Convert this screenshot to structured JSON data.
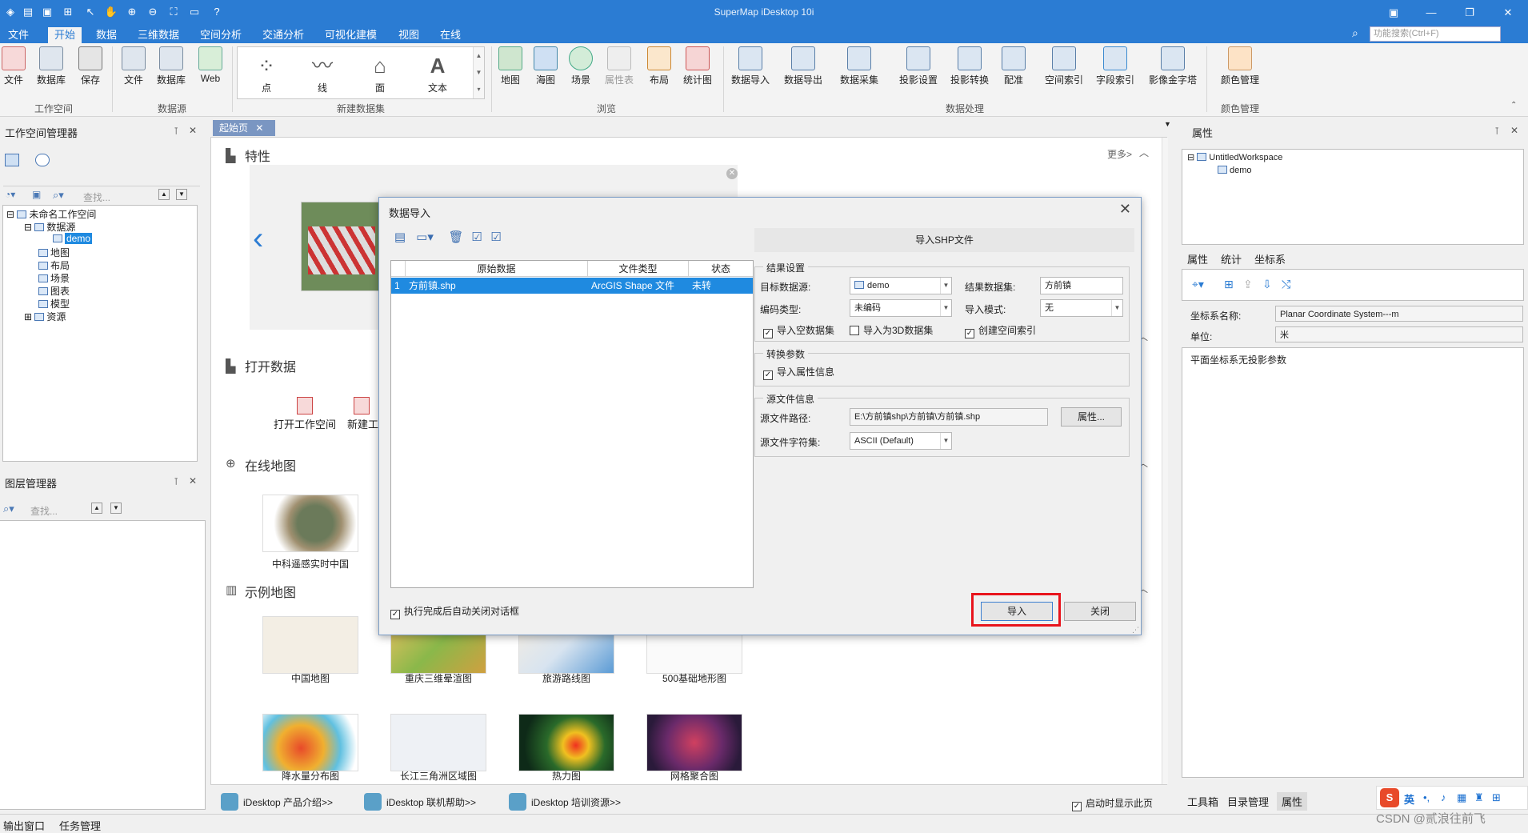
{
  "window": {
    "title": "SuperMap iDesktop 10i",
    "search_placeholder": "功能搜索(Ctrl+F)"
  },
  "menu": {
    "tabs": [
      "文件",
      "开始",
      "数据",
      "三维数据",
      "空间分析",
      "交通分析",
      "可视化建模",
      "视图",
      "在线"
    ],
    "active": "开始"
  },
  "ribbon": {
    "workspace": {
      "items": [
        "文件",
        "数据库",
        "保存"
      ],
      "group": "工作空间"
    },
    "datasource": {
      "items": [
        "文件",
        "数据库",
        "Web"
      ],
      "group": "数据源"
    },
    "new_dataset": {
      "items": [
        "点",
        "线",
        "面",
        "文本"
      ],
      "group": "新建数据集"
    },
    "browse": {
      "items": [
        "地图",
        "海图",
        "场景",
        "属性表",
        "布局",
        "统计图"
      ],
      "group": "浏览"
    },
    "data_processing": {
      "items": [
        "数据导入",
        "数据导出",
        "数据采集",
        "投影设置",
        "投影转换",
        "配准",
        "空间索引",
        "字段索引",
        "影像金字塔"
      ],
      "group": "数据处理"
    },
    "color": {
      "items": [
        "颜色管理"
      ],
      "group": "颜色管理"
    }
  },
  "workspace_manager": {
    "title": "工作空间管理器",
    "search_placeholder": "查找...",
    "tree": {
      "root": "未命名工作空间",
      "datasources": "数据源",
      "demo": "demo",
      "items": [
        "地图",
        "布局",
        "场景",
        "图表",
        "模型",
        "资源"
      ]
    }
  },
  "layer_manager": {
    "title": "图层管理器",
    "search_placeholder": "查找..."
  },
  "start_page": {
    "tab": "起始页",
    "features_title": "特性",
    "more": "更多>",
    "open_data_title": "打开数据",
    "open_workspace": "打开工作空间",
    "new_workspace_partial": "新建工",
    "online_map_title": "在线地图",
    "online_map_label": "中科遥感实时中国",
    "sample_maps_title": "示例地图",
    "sample_maps": [
      "中国地图",
      "重庆三维晕渲图",
      "旅游路线图",
      "500基础地形图",
      "降水量分布图",
      "长江三角洲区域图",
      "热力图",
      "网格聚合图"
    ],
    "footer_links": [
      "iDesktop 产品介绍>>",
      "iDesktop 联机帮助>>",
      "iDesktop 培训资源>>"
    ],
    "show_on_startup": "启动时显示此页"
  },
  "dialog": {
    "title": "数据导入",
    "grid_headers": [
      "原始数据",
      "文件类型",
      "状态"
    ],
    "grid_rows": [
      {
        "index": "1",
        "name": "方前镇.shp",
        "type": "ArcGIS Shape 文件",
        "status": "未转"
      }
    ],
    "right_header": "导入SHP文件",
    "result_settings": {
      "legend": "结果设置",
      "target_datasource_label": "目标数据源:",
      "target_datasource": "demo",
      "result_dataset_label": "结果数据集:",
      "result_dataset": "方前镇",
      "encoding_label": "编码类型:",
      "encoding": "未编码",
      "import_mode_label": "导入模式:",
      "import_mode": "无",
      "chk_empty": "导入空数据集",
      "chk_3d": "导入为3D数据集",
      "chk_index": "创建空间索引"
    },
    "conversion": {
      "legend": "转换参数",
      "chk_attr": "导入属性信息"
    },
    "source_info": {
      "legend": "源文件信息",
      "path_label": "源文件路径:",
      "path": "E:\\方前镇shp\\方前镇\\方前镇.shp",
      "props_button": "属性...",
      "charset_label": "源文件字符集:",
      "charset": "ASCII (Default)"
    },
    "auto_close": "执行完成后自动关闭对话框",
    "import_button": "导入",
    "close_button": "关闭",
    "highlight_color": "#e8141c"
  },
  "properties_panel": {
    "title": "属性",
    "tree_root": "UntitledWorkspace",
    "tree_child": "demo",
    "tabs": [
      "属性",
      "统计",
      "坐标系"
    ],
    "coord_name_label": "坐标系名称:",
    "coord_name": "Planar Coordinate System---m",
    "unit_label": "单位:",
    "unit": "米",
    "description": "平面坐标系无投影参数",
    "bottom_tabs": [
      "工具箱",
      "目录管理",
      "属性"
    ]
  },
  "status": {
    "tabs": [
      "输出窗口",
      "任务管理"
    ],
    "watermark": "CSDN @贰浪往前飞",
    "ime": "英"
  }
}
